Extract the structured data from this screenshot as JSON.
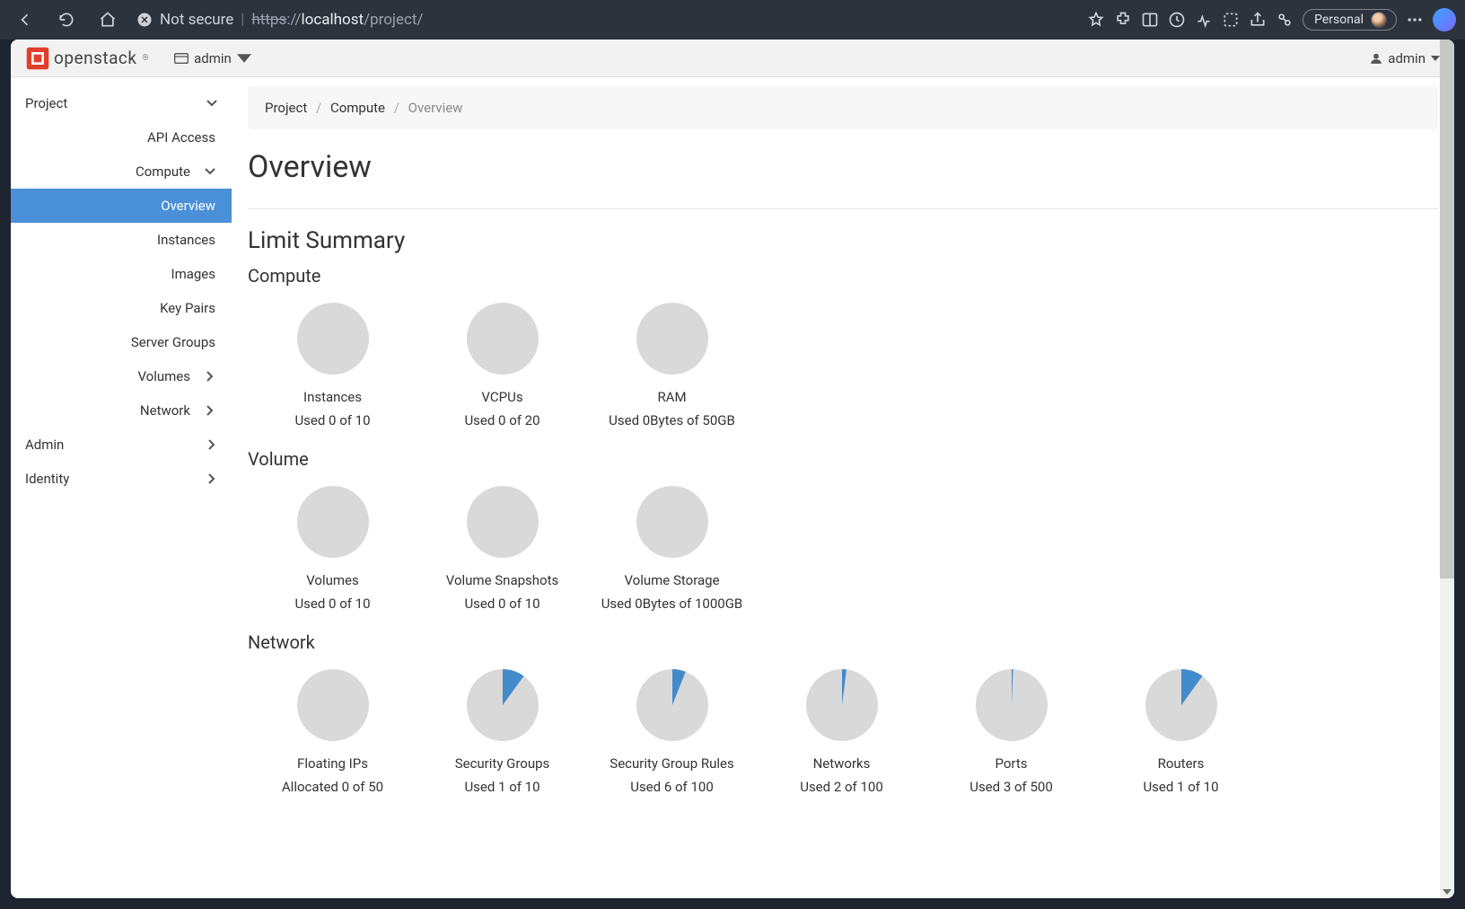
{
  "browser": {
    "not_secure_label": "Not secure",
    "url_proto": "https",
    "url_sep": "://",
    "url_host": "localhost",
    "url_path": "/project/",
    "profile_label": "Personal"
  },
  "topbar": {
    "brand": "openstack",
    "project_selector": "admin",
    "user_menu": "admin"
  },
  "sidebar": {
    "project": "Project",
    "api_access": "API Access",
    "compute": "Compute",
    "compute_items": {
      "overview": "Overview",
      "instances": "Instances",
      "images": "Images",
      "key_pairs": "Key Pairs",
      "server_groups": "Server Groups"
    },
    "volumes": "Volumes",
    "network": "Network",
    "admin": "Admin",
    "identity": "Identity"
  },
  "breadcrumb": {
    "project": "Project",
    "compute": "Compute",
    "overview": "Overview"
  },
  "headings": {
    "page_title": "Overview",
    "limit_summary": "Limit Summary",
    "compute": "Compute",
    "volume": "Volume",
    "network": "Network"
  },
  "quotas": {
    "compute": [
      {
        "label": "Instances",
        "usage": "Used 0 of 10",
        "pct": 0
      },
      {
        "label": "VCPUs",
        "usage": "Used 0 of 20",
        "pct": 0
      },
      {
        "label": "RAM",
        "usage": "Used 0Bytes of 50GB",
        "pct": 0
      }
    ],
    "volume": [
      {
        "label": "Volumes",
        "usage": "Used 0 of 10",
        "pct": 0
      },
      {
        "label": "Volume Snapshots",
        "usage": "Used 0 of 10",
        "pct": 0
      },
      {
        "label": "Volume Storage",
        "usage": "Used 0Bytes of 1000GB",
        "pct": 0
      }
    ],
    "network": [
      {
        "label": "Floating IPs",
        "usage": "Allocated 0 of 50",
        "pct": 0
      },
      {
        "label": "Security Groups",
        "usage": "Used 1 of 10",
        "pct": 10
      },
      {
        "label": "Security Group Rules",
        "usage": "Used 6 of 100",
        "pct": 6
      },
      {
        "label": "Networks",
        "usage": "Used 2 of 100",
        "pct": 2
      },
      {
        "label": "Ports",
        "usage": "Used 3 of 500",
        "pct": 0.6
      },
      {
        "label": "Routers",
        "usage": "Used 1 of 10",
        "pct": 10
      }
    ]
  },
  "chart_data": {
    "type": "pie",
    "note": "Each pie shows used fraction of quota. Grey = total, blue slice = used.",
    "series": [
      {
        "group": "Compute",
        "name": "Instances",
        "used": 0,
        "limit": 10
      },
      {
        "group": "Compute",
        "name": "VCPUs",
        "used": 0,
        "limit": 20
      },
      {
        "group": "Compute",
        "name": "RAM",
        "used_bytes": 0,
        "limit_gb": 50
      },
      {
        "group": "Volume",
        "name": "Volumes",
        "used": 0,
        "limit": 10
      },
      {
        "group": "Volume",
        "name": "Volume Snapshots",
        "used": 0,
        "limit": 10
      },
      {
        "group": "Volume",
        "name": "Volume Storage",
        "used_bytes": 0,
        "limit_gb": 1000
      },
      {
        "group": "Network",
        "name": "Floating IPs",
        "used": 0,
        "limit": 50
      },
      {
        "group": "Network",
        "name": "Security Groups",
        "used": 1,
        "limit": 10
      },
      {
        "group": "Network",
        "name": "Security Group Rules",
        "used": 6,
        "limit": 100
      },
      {
        "group": "Network",
        "name": "Networks",
        "used": 2,
        "limit": 100
      },
      {
        "group": "Network",
        "name": "Ports",
        "used": 3,
        "limit": 500
      },
      {
        "group": "Network",
        "name": "Routers",
        "used": 1,
        "limit": 10
      }
    ]
  }
}
